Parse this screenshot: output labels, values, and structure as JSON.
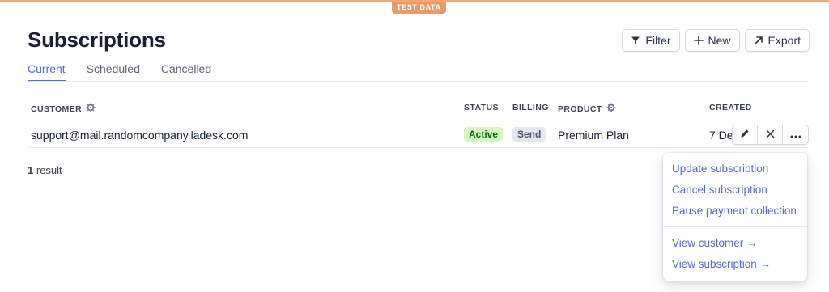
{
  "environment": {
    "badge": "TEST DATA"
  },
  "page": {
    "title": "Subscriptions"
  },
  "toolbar": {
    "filter_label": "Filter",
    "new_label": "New",
    "export_label": "Export"
  },
  "tabs": [
    {
      "label": "Current",
      "active": true
    },
    {
      "label": "Scheduled",
      "active": false
    },
    {
      "label": "Cancelled",
      "active": false
    }
  ],
  "table": {
    "columns": {
      "customer": "CUSTOMER",
      "status": "STATUS",
      "billing": "BILLING",
      "product": "PRODUCT",
      "created": "CREATED"
    },
    "rows": [
      {
        "customer": "support@mail.randomcompany.ladesk.com",
        "status": "Active",
        "billing": "Send",
        "product": "Premium Plan",
        "created": "7 Dec"
      }
    ],
    "result_count": "1",
    "result_label": "result"
  },
  "context_menu": {
    "items": [
      "Update subscription",
      "Cancel subscription",
      "Pause payment collection"
    ],
    "links": [
      "View customer →",
      "View subscription →"
    ]
  },
  "colors": {
    "accent": "#5469d4",
    "test_banner": "#e89a6a",
    "status_active_bg": "#d7f7c2",
    "status_active_text": "#05690d"
  }
}
